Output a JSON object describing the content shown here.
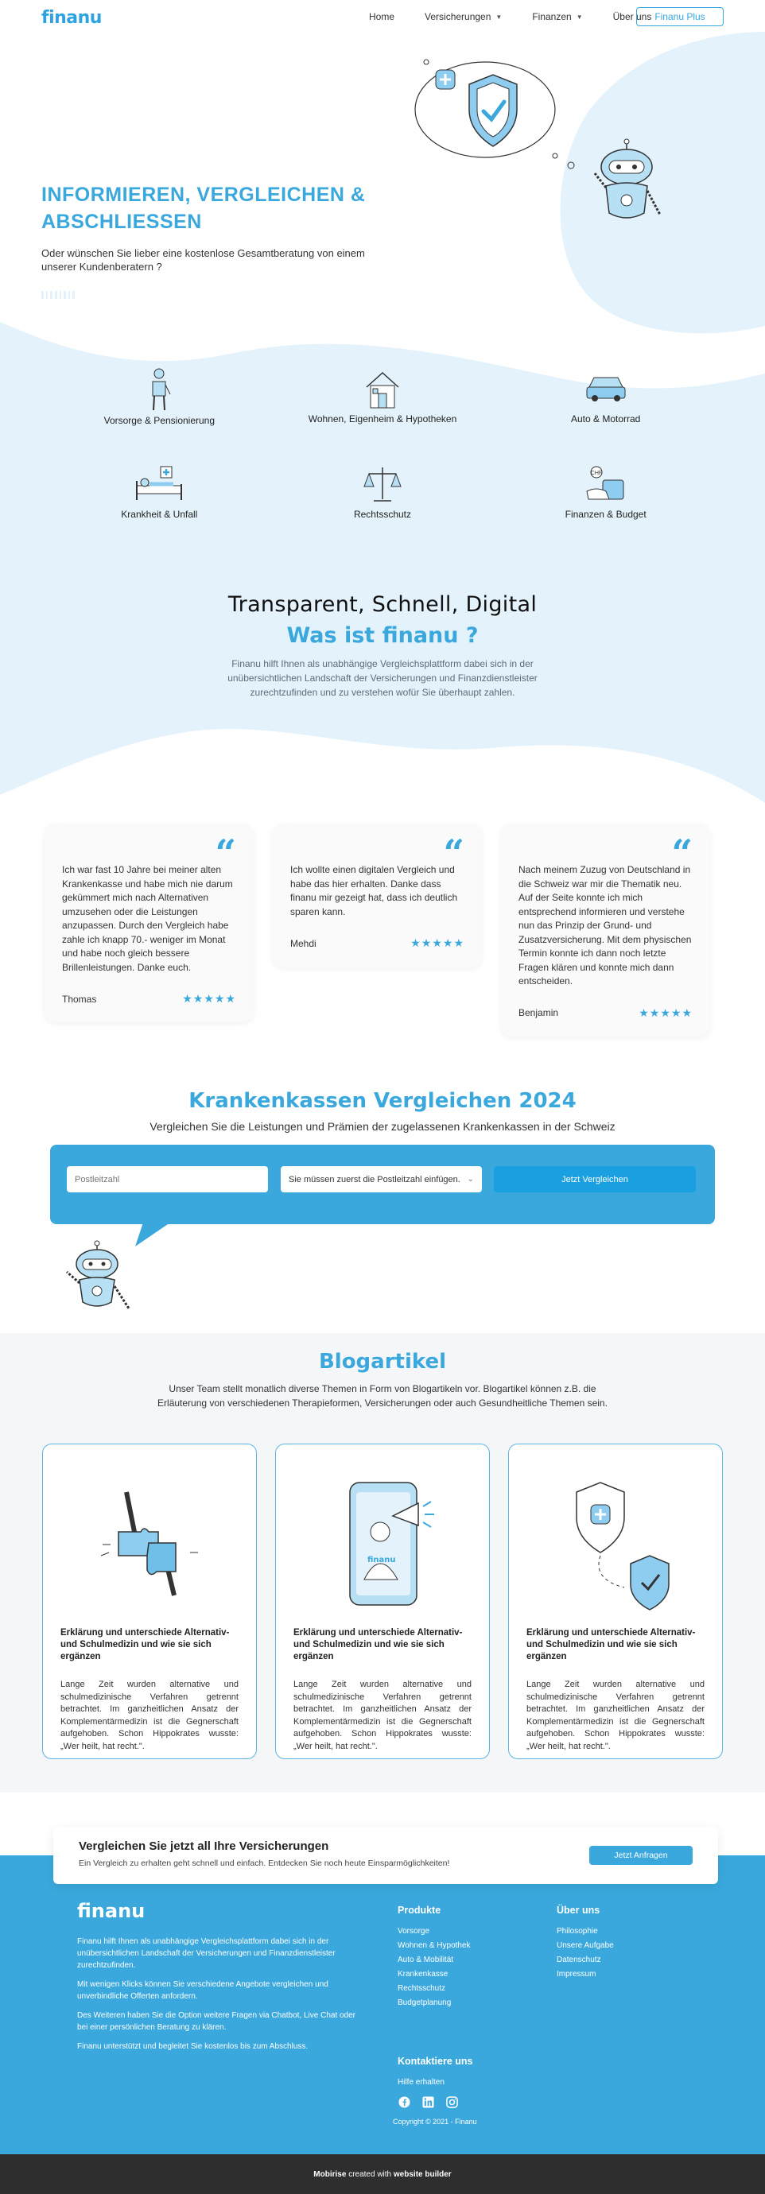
{
  "header": {
    "logo": "finanu",
    "nav": [
      {
        "label": "Home",
        "dropdown": false
      },
      {
        "label": "Versicherungen",
        "dropdown": true
      },
      {
        "label": "Finanzen",
        "dropdown": true
      },
      {
        "label": "Über uns",
        "dropdown": false
      }
    ],
    "cta_label": "Finanu Plus"
  },
  "hero": {
    "title": "INFORMIEREN, VERGLEICHEN & ABSCHLIESSEN",
    "subtitle": "Oder wünschen Sie lieber eine kostenlose Gesamtberatung von einem unserer Kundenberatern ?"
  },
  "categories": [
    {
      "label": "Vorsorge & Pensionierung",
      "icon": "pension-person-icon"
    },
    {
      "label": "Wohnen, Eigenheim & Hypotheken",
      "icon": "house-icon"
    },
    {
      "label": "Auto & Motorrad",
      "icon": "car-icon"
    },
    {
      "label": "Krankheit & Unfall",
      "icon": "hospital-bed-icon"
    },
    {
      "label": "Rechtsschutz",
      "icon": "scales-icon"
    },
    {
      "label": "Finanzen & Budget",
      "icon": "money-hand-icon"
    }
  ],
  "about": {
    "title": "Transparent, Schnell, Digital",
    "subtitle": "Was ist finanu ?",
    "text": "Finanu hilft Ihnen als unabhängige Vergleichsplattform dabei sich in der unübersichtlichen Landschaft der Versicherungen und Finanzdienstleister zurechtzufinden und zu verstehen wofür Sie überhaupt zahlen."
  },
  "testimonials": [
    {
      "text": "Ich war fast 10 Jahre bei meiner alten Krankenkasse und habe mich nie darum gekümmert mich nach Alternativen umzusehen oder die Leistungen anzupassen. Durch den Vergleich habe zahle ich knapp 70.- weniger im Monat und habe noch gleich bessere Brillenleistungen. Danke euch.",
      "name": "Thomas",
      "rating": 5
    },
    {
      "text": "Ich wollte einen digitalen Vergleich und habe das hier erhalten. Danke dass finanu mir gezeigt hat, dass ich deutlich sparen kann.",
      "name": "Mehdi",
      "rating": 5
    },
    {
      "text": "Nach meinem Zuzug von Deutschland in die Schweiz war mir die Thematik neu. Auf der Seite konnte ich mich entsprechend informieren und verstehe nun das Prinzip der Grund- und Zusatzversicherung. Mit dem physischen Termin konnte ich dann noch letzte Fragen klären und konnte mich dann entscheiden.",
      "name": "Benjamin",
      "rating": 5
    }
  ],
  "kk": {
    "title": "Krankenkassen Vergleichen 2024",
    "subtitle": "Vergleichen Sie die Leistungen und Prämien der zugelassenen Krankenkassen in der Schweiz",
    "zip_placeholder": "Postleitzahl",
    "select_value": "Sie müssen zuerst die Postleitzahl einfügen.",
    "button": "Jetzt Vergleichen"
  },
  "blog": {
    "title": "Blogartikel",
    "text": "Unser Team stellt monatlich diverse Themen in Form von Blogartikeln vor. Blogartikel können z.B. die Erläuterung von verschiedenen Therapieformen, Versicherungen oder auch Gesundheitliche Themen sein.",
    "cards": [
      {
        "title": "Erklärung und unterschiede Alternativ- und Schulmedizin und wie sie sich ergänzen",
        "text": "Lange Zeit wurden alternative und schulmedizinische Verfahren getrennt betrachtet. Im ganzheitlichen Ansatz der Komplementärmedizin ist die Gegnerschaft aufgehoben. Schon Hippokrates wusste: „Wer heilt, hat recht.\".",
        "illustration": "puzzle-hands-illustration"
      },
      {
        "title": "Erklärung und unterschiede Alternativ- und Schulmedizin und wie sie sich ergänzen",
        "text": "Lange Zeit wurden alternative und schulmedizinische Verfahren getrennt betrachtet. Im ganzheitlichen Ansatz der Komplementärmedizin ist die Gegnerschaft aufgehoben. Schon Hippokrates wusste: „Wer heilt, hat recht.\".",
        "illustration": "phone-megaphone-illustration",
        "phone_label": "finanu"
      },
      {
        "title": "Erklärung und unterschiede Alternativ- und Schulmedizin und wie sie sich ergänzen",
        "text": "Lange Zeit wurden alternative und schulmedizinische Verfahren getrennt betrachtet. Im ganzheitlichen Ansatz der Komplementärmedizin ist die Gegnerschaft aufgehoben. Schon Hippokrates wusste: „Wer heilt, hat recht.\".",
        "illustration": "shields-illustration"
      }
    ]
  },
  "cta": {
    "title": "Vergleichen Sie jetzt all Ihre Versicherungen",
    "text": "Ein Vergleich zu erhalten geht schnell und einfach. Entdecken Sie noch heute Einsparmöglichkeiten!",
    "button": "Jetzt Anfragen"
  },
  "footer": {
    "logo": "finanu",
    "desc": [
      "Finanu hilft Ihnen als unabhängige Vergleichsplattform dabei sich in der unübersichtlichen Landschaft der Versicherungen und Finanzdienstleister zurechtzufinden.",
      "Mit wenigen Klicks können Sie verschiedene Angebote vergleichen und unverbindliche Offerten anfordern.",
      "Des Weiteren haben Sie die Option weitere Fragen via Chatbot, Live Chat oder bei einer persönlichen Beratung zu klären.",
      "Finanu unterstützt und begleitet Sie kostenlos bis zum Abschluss."
    ],
    "produkte_title": "Produkte",
    "produkte": [
      "Vorsorge",
      "Wohnen & Hypothek",
      "Auto & Mobilität",
      "Krankenkasse",
      "Rechtsschutz",
      "Budgetplanung"
    ],
    "about_title": "Über uns",
    "about": [
      "Philosophie",
      "Unsere Aufgabe",
      "Datenschutz",
      "Impressum"
    ],
    "contact_title": "Kontaktiere uns",
    "contact": "Hilfe erhalten",
    "copyright": "Copyright © 2021 - Finanu",
    "built_text": "created with",
    "built_a": "Mobirise",
    "built_b": "website builder"
  },
  "colors": {
    "primary": "#3aa8dd",
    "light_blue": "#e3f2fb",
    "dark": "#2e2e2e"
  }
}
